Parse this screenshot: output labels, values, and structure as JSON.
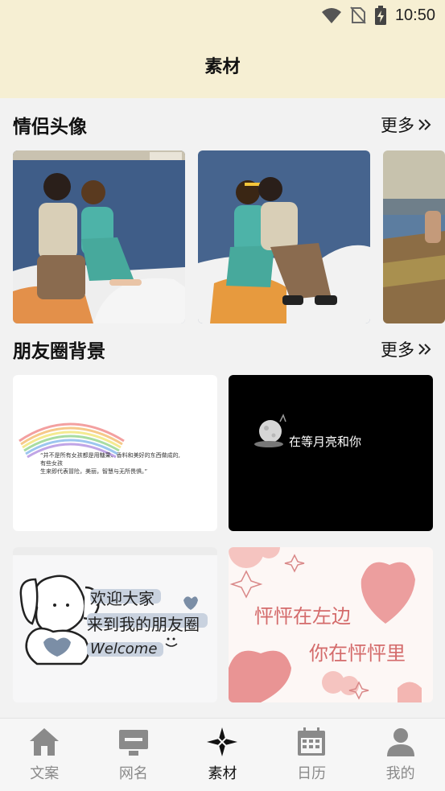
{
  "status_bar": {
    "time": "10:50",
    "icons": [
      "wifi-icon",
      "no-sim-icon",
      "battery-charging-icon"
    ]
  },
  "header": {
    "title": "素材"
  },
  "sections": [
    {
      "title": "情侣头像",
      "more_label": "更多"
    },
    {
      "title": "朋友圈背景",
      "more_label": "更多"
    }
  ],
  "avatar_cards": [
    {
      "description": "couple photo by the lake"
    },
    {
      "description": "couple photo by the lake"
    },
    {
      "description": "couple photo partially visible"
    }
  ],
  "background_cards": [
    {
      "quote_line1": "“并不是所有女孩都是用糖果、香料和美好的东西做成的,",
      "quote_line2": "有些女孩",
      "quote_line3": "生来即代表冒险，美丽，智慧与无所畏惧。”"
    },
    {
      "caption": "在等月亮和你"
    },
    {
      "line1": "欢迎大家",
      "line2": "来到我的朋友圈",
      "line3": "Welcome"
    },
    {
      "line1": "怦怦在左边",
      "line2": "你在怦怦里"
    }
  ],
  "bottom_nav": [
    {
      "label": "文案",
      "icon": "home-icon",
      "active": false
    },
    {
      "label": "网名",
      "icon": "monitor-icon",
      "active": false
    },
    {
      "label": "素材",
      "icon": "sparkle-icon",
      "active": true
    },
    {
      "label": "日历",
      "icon": "calendar-icon",
      "active": false
    },
    {
      "label": "我的",
      "icon": "person-icon",
      "active": false
    }
  ],
  "colors": {
    "header_bg": "#f6efd3",
    "page_bg": "#f2f2f2",
    "nav_inactive": "#8a8a8a",
    "nav_active": "#111111"
  }
}
